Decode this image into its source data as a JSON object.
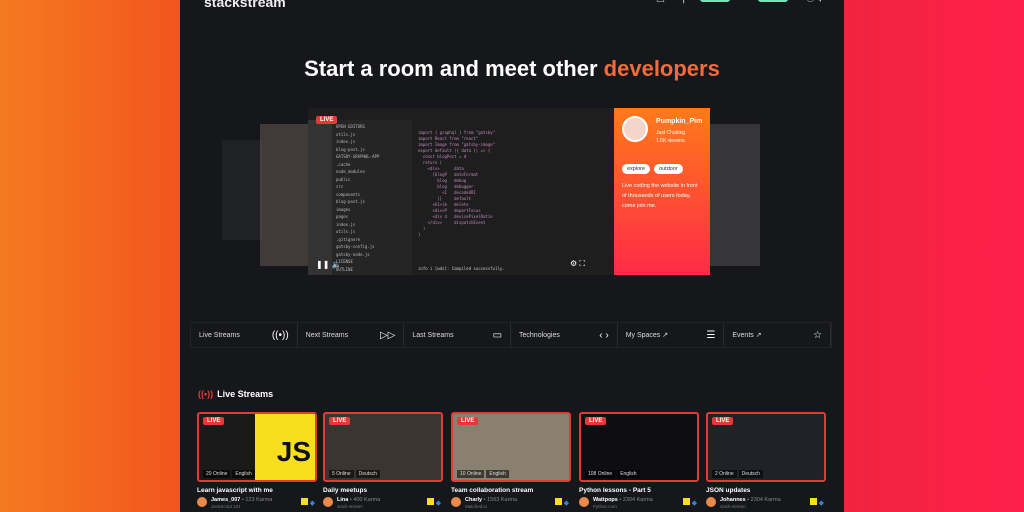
{
  "header": {
    "logo": "stackstream",
    "build_label": "build",
    "stream_label": "stream",
    "icons": [
      "chat-icon",
      "search-icon",
      "user-icon"
    ]
  },
  "hero": {
    "title_prefix": "Start a room and meet other ",
    "title_accent": "developers",
    "accent_color": "#f26b3a"
  },
  "featured": {
    "live_label": "LIVE",
    "editor": {
      "files": [
        "OPEN EDITORS",
        "utils.js",
        "index.js",
        "blog-post.js",
        "GATSBY-GRAPHQL-APP",
        ".cache",
        "node_modules",
        "public",
        "src",
        "components",
        "blog-post.js",
        "images",
        "pages",
        "index.js",
        "utils.js",
        ".gitignore",
        "gatsby-config.js",
        "gatsby-node.js",
        "LICENSE",
        "OUTLINE"
      ],
      "code": [
        "import { graphql } from \"gatsby\"",
        "import React from \"react\"",
        "import Image from \"gatsby-image\"",
        "",
        "export default ({ data }) => {",
        "  const blogPost = d",
        "  return (",
        "    <div>      data",
        "      {blogP   dateFormat",
        "        blog   debug",
        "        blog   debugger",
        "          <I   decodeURI",
        "        )}     default",
        "      <h1>{b   delete",
        "      <div>P   departFocus",
        "      <div d   devicePixelRatio",
        "    </div>     dispatchEvent",
        "  )",
        "}"
      ],
      "terminal": "info i [wds]: Compiled successfully."
    },
    "streamer": {
      "name": "Pumpkin_Pim",
      "category": "Just Chatting",
      "viewers": "1.6K viewers",
      "tags": [
        "explore",
        "outdoor"
      ],
      "description": "Live coding the website in front of thousands of users today, come join me."
    }
  },
  "nav": [
    {
      "label": "Live Streams",
      "icon": "broadcast-icon"
    },
    {
      "label": "Next Streams",
      "icon": "fast-forward-icon"
    },
    {
      "label": "Last Streams",
      "icon": "video-camera-icon"
    },
    {
      "label": "Technologies",
      "icon": "code-icon"
    },
    {
      "label": "My Spaces ↗",
      "icon": "stack-icon"
    },
    {
      "label": "Events ↗",
      "icon": "star-badge-icon"
    }
  ],
  "live_section": {
    "title": "Live Streams",
    "streams": [
      {
        "title": "Learn javascript with me",
        "online": "20 Online",
        "language": "English",
        "user": "James_007",
        "karma": "• 123 Karma",
        "org": "JavaScript 101",
        "thumb": "#1a1a1a"
      },
      {
        "title": "Daily meetups",
        "online": "5 Online",
        "language": "Deutsch",
        "user": "Lina",
        "karma": "• 400 Karma",
        "org": "stack-stream",
        "thumb": "#3a3530"
      },
      {
        "title": "Team collaboration stream",
        "online": "10 Online",
        "language": "English",
        "user": "Charly",
        "karma": "• 1563 Karma",
        "org": "Matched.io",
        "thumb": "#8a8070"
      },
      {
        "title": "Python lessons - Part 5",
        "online": "108 Online",
        "language": "English",
        "user": "Wattpops",
        "karma": "• 2304 Karma",
        "org": "Python.com",
        "thumb": "#0e0e12"
      },
      {
        "title": "JSON updates",
        "online": "2 Online",
        "language": "Deutsch",
        "user": "Johannes",
        "karma": "• 2304 Karma",
        "org": "stack-stream",
        "thumb": "#202228"
      }
    ]
  }
}
